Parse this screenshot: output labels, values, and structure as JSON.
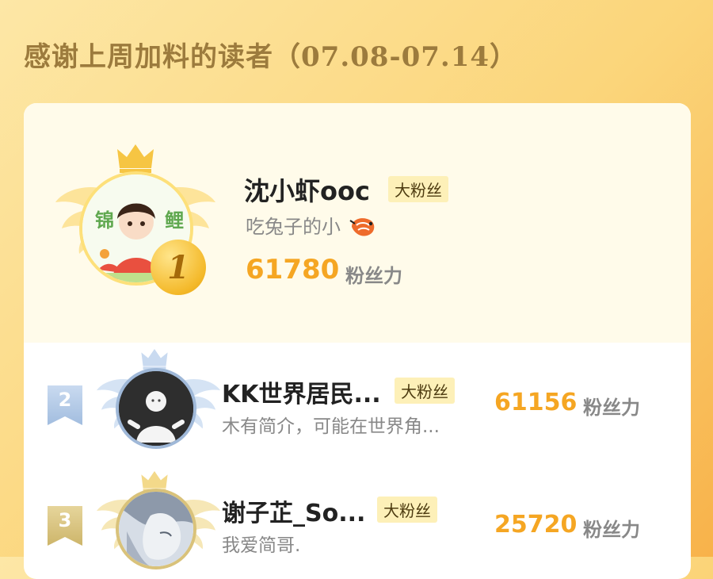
{
  "header": {
    "title": "感谢上周加料的读者（07.08-07.14）"
  },
  "leaderboard": [
    {
      "rank": "1",
      "name": "沈小虾ooc",
      "tag": "大粉丝",
      "bio": "吃兔子的小",
      "bio_icon": "shrimp-icon",
      "avatar_text": [
        "锦",
        "鲤"
      ],
      "score": "61780",
      "unit": "粉丝力"
    },
    {
      "rank": "2",
      "name": "KK世界居民...",
      "tag": "大粉丝",
      "bio": "木有简介，可能在世界角...",
      "score": "61156",
      "unit": "粉丝力"
    },
    {
      "rank": "3",
      "name": "谢子芷_So...",
      "tag": "大粉丝",
      "bio": "我爱简哥.",
      "score": "25720",
      "unit": "粉丝力"
    }
  ],
  "colors": {
    "accent_score": "#f5a623",
    "title": "#9c7b3d",
    "gold": "#f4b92a",
    "silver": "#a9c3e0",
    "bronze": "#d8c27a"
  }
}
